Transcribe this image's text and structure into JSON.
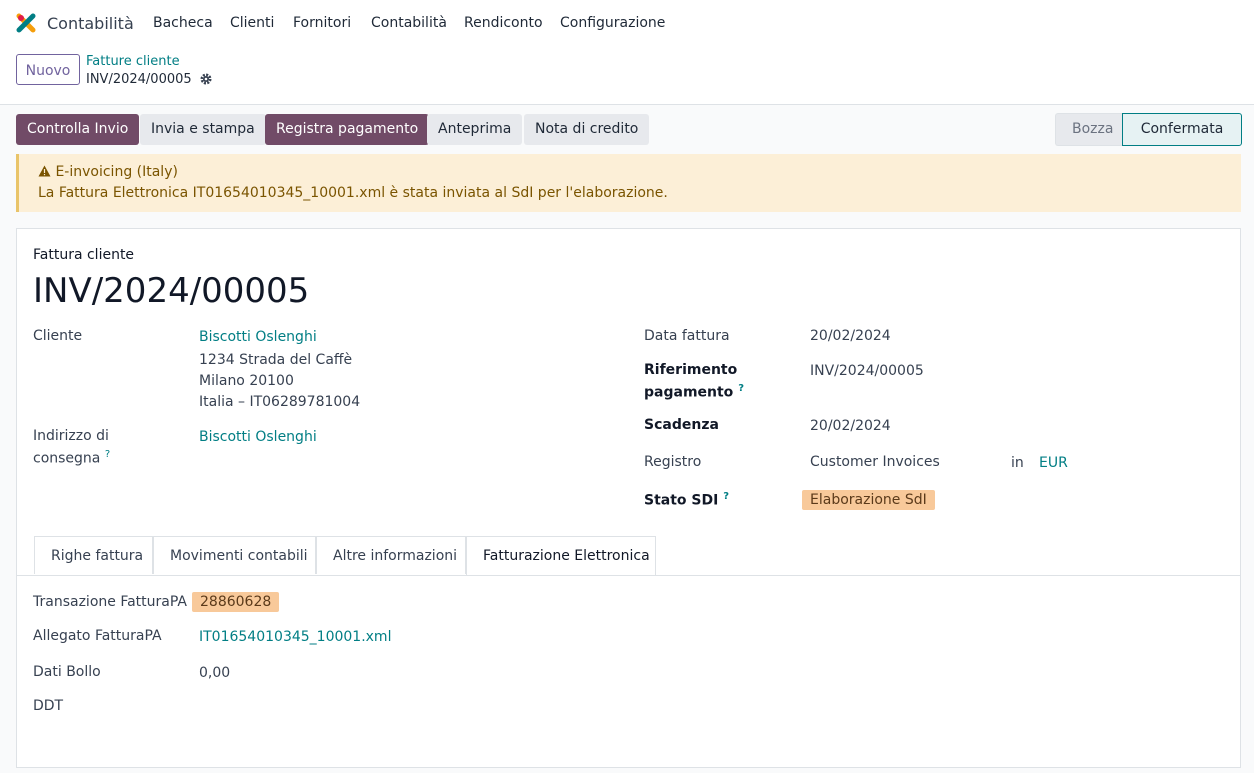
{
  "app": {
    "title": "Contabilità"
  },
  "menu": [
    "Bacheca",
    "Clienti",
    "Fornitori",
    "Contabilità",
    "Rendiconto",
    "Configurazione"
  ],
  "control_panel": {
    "new_button": "Nuovo",
    "breadcrumb_parent": "Fatture cliente",
    "breadcrumb_current": "INV/2024/00005"
  },
  "actions": {
    "controlla_invio": "Controlla Invio",
    "invia_stampa": "Invia e stampa",
    "registra_pagamento": "Registra pagamento",
    "anteprima": "Anteprima",
    "nota_credito": "Nota di credito"
  },
  "status": {
    "draft": "Bozza",
    "confirmed": "Confermata"
  },
  "alert": {
    "title": "E-invoicing (Italy)",
    "message": "La Fattura Elettronica IT01654010345_10001.xml è stata inviata al SdI per l'elaborazione.",
    "color": "#fcefd7"
  },
  "invoice": {
    "type_label": "Fattura cliente",
    "number": "INV/2024/00005",
    "customer_label": "Cliente",
    "customer_name": "Biscotti Oslenghi",
    "address_line1": "1234 Strada del Caffè",
    "address_line2": "Milano 20100",
    "address_line3": "Italia – IT06289781004",
    "delivery_label_1": "Indirizzo di",
    "delivery_label_2": "consegna",
    "delivery_value": "Biscotti Oslenghi",
    "date_label": "Data fattura",
    "date_value": "20/02/2024",
    "ref_label_1": "Riferimento",
    "ref_label_2": "pagamento",
    "ref_value": "INV/2024/00005",
    "due_label": "Scadenza",
    "due_value": "20/02/2024",
    "journal_label": "Registro",
    "journal_value": "Customer Invoices",
    "in_label": "in",
    "currency": "EUR",
    "sdi_label": "Stato SDI",
    "sdi_value": "Elaborazione SdI",
    "help_mark": "?"
  },
  "tabs": [
    "Righe fattura",
    "Movimenti contabili",
    "Altre informazioni",
    "Fatturazione Elettronica"
  ],
  "einvoice": {
    "transaction_label": "Transazione FatturaPA",
    "transaction_value": "28860628",
    "attachment_label": "Allegato FatturaPA",
    "attachment_value": "IT01654010345_10001.xml",
    "bollo_label": "Dati Bollo",
    "bollo_value": "0,00",
    "ddt_label": "DDT"
  },
  "colors": {
    "primary": "#714b67",
    "link": "#017e84",
    "badge": "#f8c99a"
  }
}
